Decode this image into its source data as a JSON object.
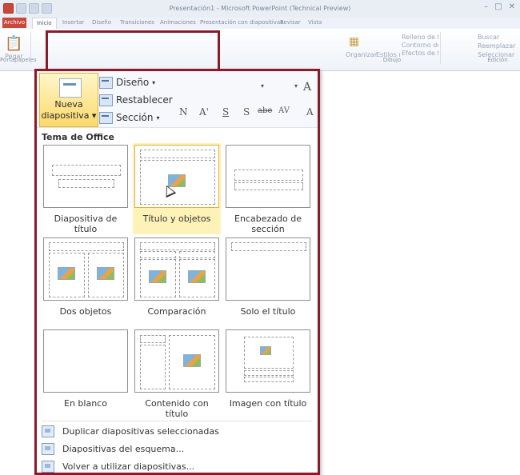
{
  "window": {
    "title": "Presentación1 - Microsoft PowerPoint (Technical Preview)"
  },
  "tabs": {
    "file": "Archivo",
    "items": [
      "Inicio",
      "Insertar",
      "Diseño",
      "Transiciones",
      "Animaciones",
      "Presentación con diapositivas",
      "Revisar",
      "Vista"
    ]
  },
  "ribbon": {
    "paste": "Pegar",
    "clipboard_group": "Portapapeles",
    "drawing_group": "Dibujo",
    "editing_group": "Edición",
    "find": "Buscar",
    "replace": "Reemplazar",
    "select": "Seleccionar",
    "arrange": "Organizar",
    "quick_styles": "Estilos rápidos",
    "shape_fill": "Relleno de forma",
    "shape_outline": "Contorno de forma",
    "shape_effects": "Efectos de formas"
  },
  "panel": {
    "new_slide_line1": "Nueva",
    "new_slide_line2": "diapositiva",
    "layout_btn": "Diseño",
    "reset_btn": "Restablecer",
    "section_btn": "Sección",
    "section_header": "Tema de Office",
    "layouts": [
      {
        "line1": "Diapositiva de",
        "line2": "título"
      },
      {
        "line1": "Título y objetos",
        "line2": ""
      },
      {
        "line1": "Encabezado de",
        "line2": "sección"
      },
      {
        "line1": "Dos objetos",
        "line2": ""
      },
      {
        "line1": "Comparación",
        "line2": ""
      },
      {
        "line1": "Solo el título",
        "line2": ""
      },
      {
        "line1": "En blanco",
        "line2": ""
      },
      {
        "line1": "Contenido con",
        "line2": "título"
      },
      {
        "line1": "Imagen con título",
        "line2": ""
      }
    ],
    "selected_layout_index": 1,
    "menu": [
      {
        "label": "Duplicar diapositivas seleccionadas",
        "icon": "duplicate-slides-icon"
      },
      {
        "label": "Diapositivas del esquema...",
        "icon": "outline-slides-icon"
      },
      {
        "label": "Volver a utilizar diapositivas...",
        "icon": "reuse-slides-icon"
      }
    ]
  },
  "colors": {
    "highlight_border": "#8b1a2b",
    "selected_fill": "#fff2b8",
    "button_gold": "#fcd96b"
  }
}
